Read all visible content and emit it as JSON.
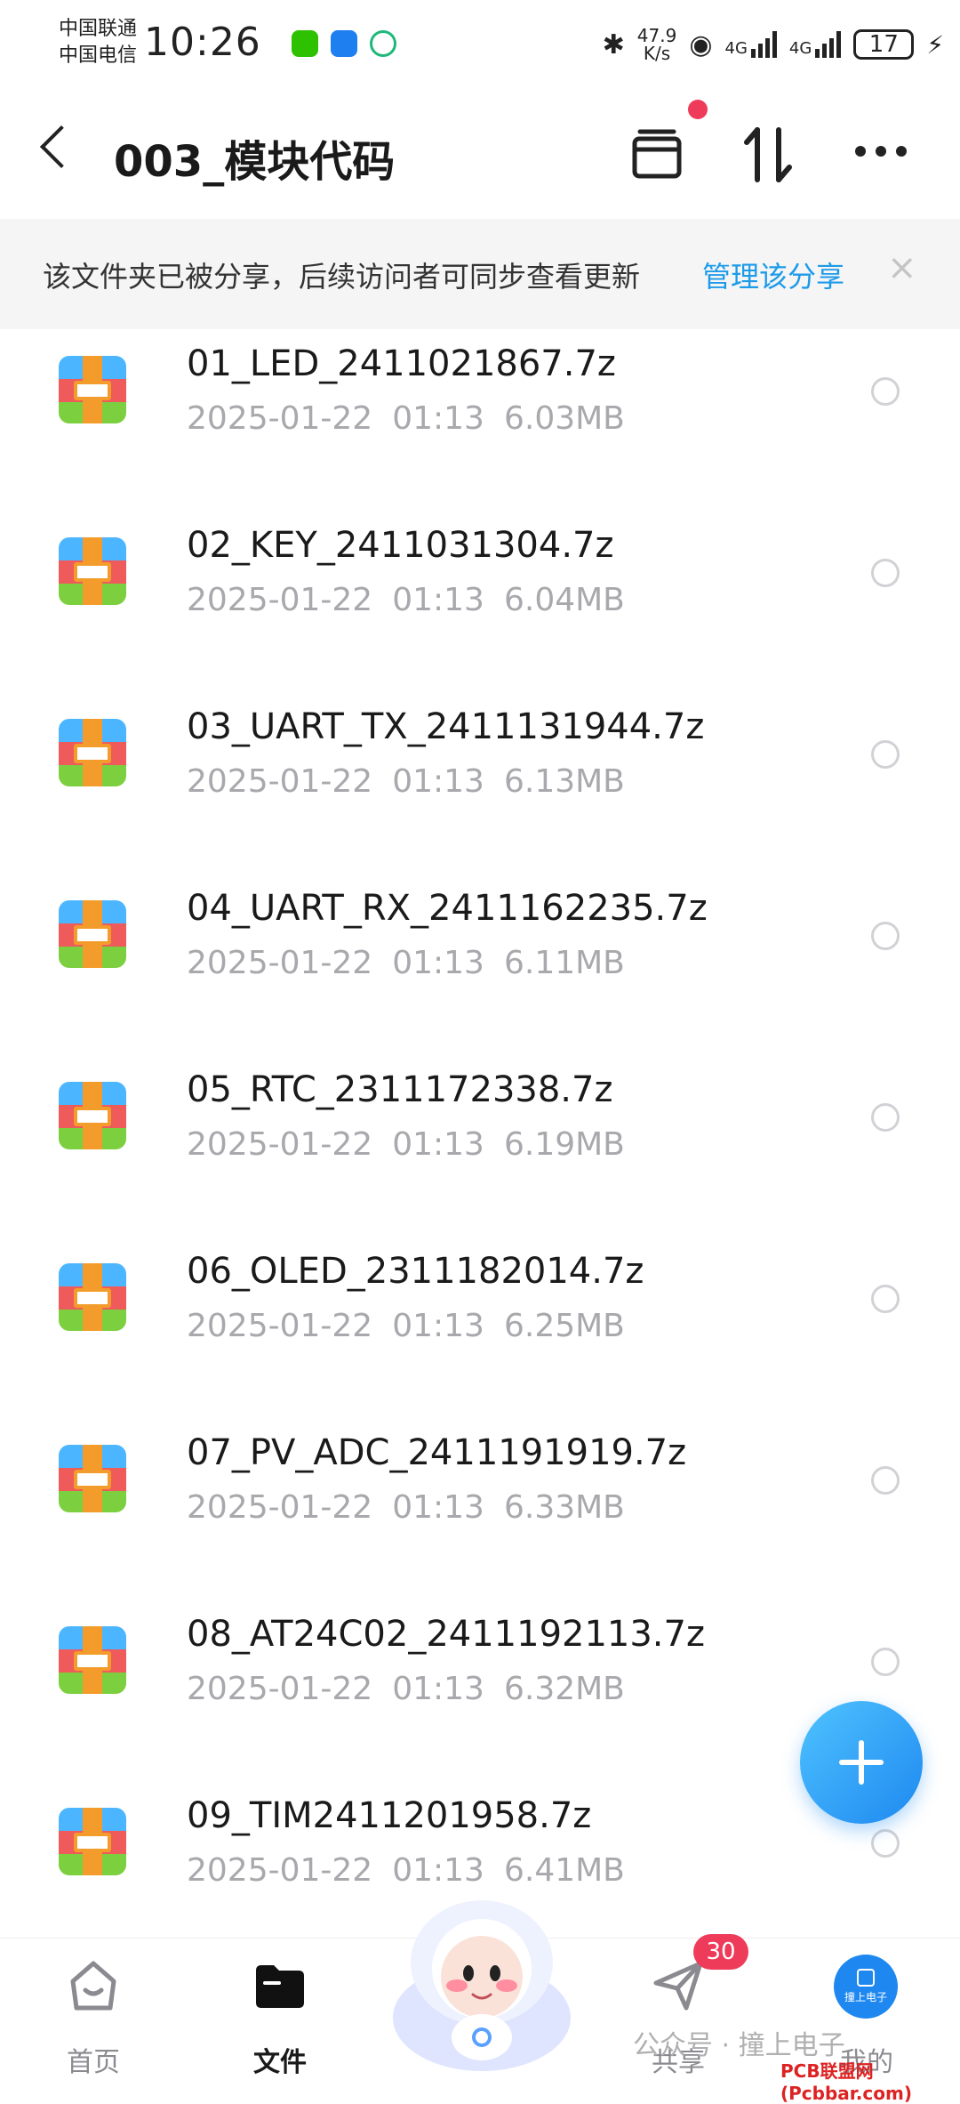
{
  "status_bar": {
    "carrier1": "中国联通",
    "carrier2": "中国电信",
    "time": "10:26",
    "speed": "47.9",
    "speed_unit": "K/s",
    "net1": "4G",
    "net2": "4G",
    "battery": "17"
  },
  "header": {
    "title": "003_模块代码"
  },
  "banner": {
    "text": "该文件夹已被分享，后续访问者可同步查看更新",
    "link": "管理该分享",
    "close": "×"
  },
  "files": [
    {
      "name": "01_LED_2411021867.7z",
      "date": "2025-01-22",
      "time": "01:13",
      "size": "6.03MB"
    },
    {
      "name": "02_KEY_2411031304.7z",
      "date": "2025-01-22",
      "time": "01:13",
      "size": "6.04MB"
    },
    {
      "name": "03_UART_TX_2411131944.7z",
      "date": "2025-01-22",
      "time": "01:13",
      "size": "6.13MB"
    },
    {
      "name": "04_UART_RX_2411162235.7z",
      "date": "2025-01-22",
      "time": "01:13",
      "size": "6.11MB"
    },
    {
      "name": "05_RTC_2311172338.7z",
      "date": "2025-01-22",
      "time": "01:13",
      "size": "6.19MB"
    },
    {
      "name": "06_OLED_2311182014.7z",
      "date": "2025-01-22",
      "time": "01:13",
      "size": "6.25MB"
    },
    {
      "name": "07_PV_ADC_2411191919.7z",
      "date": "2025-01-22",
      "time": "01:13",
      "size": "6.33MB"
    },
    {
      "name": "08_AT24C02_2411192113.7z",
      "date": "2025-01-22",
      "time": "01:13",
      "size": "6.32MB"
    },
    {
      "name": "09_TIM2411201958.7z",
      "date": "2025-01-22",
      "time": "01:13",
      "size": "6.41MB"
    }
  ],
  "nav": {
    "home": "首页",
    "files": "文件",
    "share": "共享",
    "share_badge": "30",
    "mine": "我的",
    "avatar_text": "撞上电子"
  },
  "watermark": {
    "text": "公众号 · 撞上电子",
    "site": "PCB联盟网 (Pcbbar.com)"
  },
  "colors": {
    "accent": "#1e9be8",
    "badge": "#ef3b5a"
  }
}
